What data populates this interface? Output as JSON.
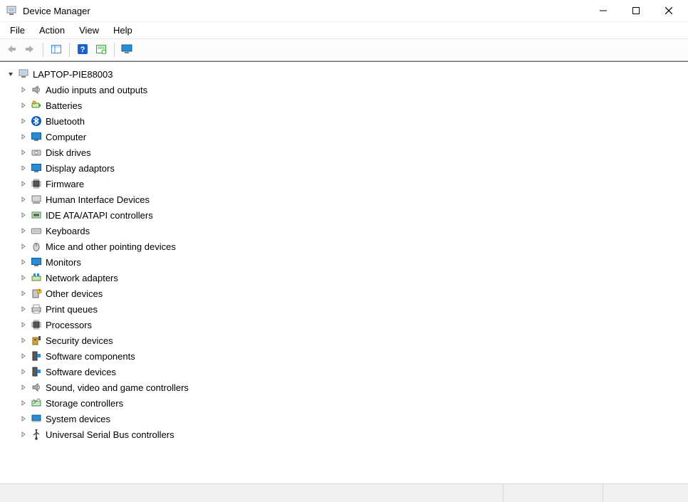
{
  "window": {
    "title": "Device Manager"
  },
  "menu": {
    "file": "File",
    "action": "Action",
    "view": "View",
    "help": "Help"
  },
  "toolbar": {
    "back": "back-icon",
    "forward": "forward-icon",
    "properties": "properties-icon",
    "help": "help-icon",
    "scan": "scan-icon",
    "monitor": "monitor-icon"
  },
  "tree": {
    "root": {
      "label": "LAPTOP-PIE88003",
      "expanded": true,
      "icon": "computer-icon"
    },
    "nodes": [
      {
        "label": "Audio inputs and outputs",
        "icon": "speaker-icon"
      },
      {
        "label": "Batteries",
        "icon": "battery-icon"
      },
      {
        "label": "Bluetooth",
        "icon": "bluetooth-icon"
      },
      {
        "label": "Computer",
        "icon": "monitor-icon"
      },
      {
        "label": "Disk drives",
        "icon": "disk-icon"
      },
      {
        "label": "Display adaptors",
        "icon": "display-adapter-icon"
      },
      {
        "label": "Firmware",
        "icon": "chip-icon"
      },
      {
        "label": "Human Interface Devices",
        "icon": "hid-icon"
      },
      {
        "label": "IDE ATA/ATAPI controllers",
        "icon": "ide-icon"
      },
      {
        "label": "Keyboards",
        "icon": "keyboard-icon"
      },
      {
        "label": "Mice and other pointing devices",
        "icon": "mouse-icon"
      },
      {
        "label": "Monitors",
        "icon": "monitor-icon"
      },
      {
        "label": "Network adapters",
        "icon": "network-icon"
      },
      {
        "label": "Other devices",
        "icon": "other-devices-icon"
      },
      {
        "label": "Print queues",
        "icon": "printer-icon"
      },
      {
        "label": "Processors",
        "icon": "processor-icon"
      },
      {
        "label": "Security devices",
        "icon": "security-icon"
      },
      {
        "label": "Software components",
        "icon": "software-components-icon"
      },
      {
        "label": "Software devices",
        "icon": "software-devices-icon"
      },
      {
        "label": "Sound, video and game controllers",
        "icon": "sound-icon"
      },
      {
        "label": "Storage controllers",
        "icon": "storage-icon"
      },
      {
        "label": "System devices",
        "icon": "system-icon"
      },
      {
        "label": "Universal Serial Bus controllers",
        "icon": "usb-icon"
      }
    ]
  }
}
